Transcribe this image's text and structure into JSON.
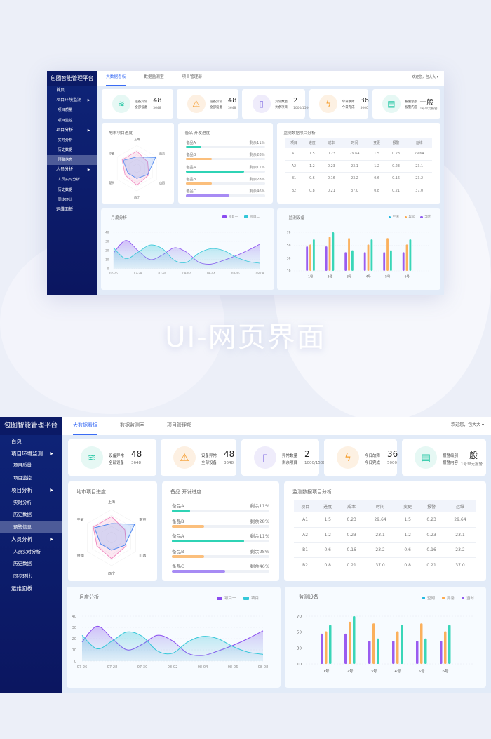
{
  "banner_title": "UI-网页界面",
  "app": {
    "title": "包图智能管理平台"
  },
  "sidebar": {
    "items": [
      {
        "label": "首页",
        "sub": false,
        "arrow": false
      },
      {
        "label": "项目环境监测",
        "sub": false,
        "arrow": true
      },
      {
        "label": "项目质量",
        "sub": true
      },
      {
        "label": "项目监控",
        "sub": true
      },
      {
        "label": "项目分析",
        "sub": false,
        "arrow": true
      },
      {
        "label": "实时分析",
        "sub": true
      },
      {
        "label": "历史数据",
        "sub": true
      },
      {
        "label": "预警信息",
        "sub": true,
        "active": true
      },
      {
        "label": "人员分析",
        "sub": false,
        "arrow": true
      },
      {
        "label": "人员实时分析",
        "sub": true
      },
      {
        "label": "历史数据",
        "sub": true
      },
      {
        "label": "同步环比",
        "sub": true
      },
      {
        "label": "运维面板",
        "sub": false
      }
    ]
  },
  "header": {
    "tabs": [
      {
        "label": "大数据看板",
        "active": true
      },
      {
        "label": "数据监测室"
      },
      {
        "label": "项目管理部"
      }
    ],
    "welcome": "欢迎您，包大大 ▾"
  },
  "stats": [
    {
      "icon": "layers-icon",
      "glyph": "≋",
      "color": "#2ec9a8",
      "bg": "#e6f8f4",
      "l1": "设备异常",
      "l2": "全部设备",
      "v1": "48",
      "v2": "3648"
    },
    {
      "icon": "warning-icon",
      "glyph": "⚠",
      "color": "#f59a2a",
      "bg": "#fdf0e2",
      "l1": "设备异常",
      "l2": "全部设备",
      "v1": "48",
      "v2": "3648"
    },
    {
      "icon": "book-icon",
      "glyph": "▯",
      "color": "#8b78e6",
      "bg": "#efecfb",
      "l1": "异常数量",
      "l2": "剩余项目",
      "v1": "2",
      "v2": "1000/1500"
    },
    {
      "icon": "lightning-icon",
      "glyph": "ϟ",
      "color": "#f5a030",
      "bg": "#fdf1e3",
      "l1": "今日故障",
      "l2": "今日完成",
      "v1": "36",
      "v2": "5000"
    },
    {
      "icon": "document-icon",
      "glyph": "▤",
      "color": "#2ec9a8",
      "bg": "#e6f8f4",
      "l1": "报警级别",
      "l2": "报警内容",
      "v1": "一般",
      "v2": "1号单元报警"
    }
  ],
  "radar": {
    "title": "地市项目进度",
    "axes": [
      "上海",
      "南京",
      "山西",
      "西宁",
      "楚明",
      "宁夏"
    ],
    "series": [
      {
        "color": "#f08bc0",
        "values": [
          0.75,
          0.55,
          0.6,
          0.75,
          0.6,
          0.75
        ]
      },
      {
        "color": "#4d86f0",
        "values": [
          0.5,
          0.95,
          0.55,
          0.45,
          0.45,
          0.7
        ]
      }
    ]
  },
  "progress": {
    "title": "备品 开发进度",
    "items": [
      {
        "label": "备品A",
        "remain": "剩余11%",
        "fill": 19,
        "color": "#2fd3b5"
      },
      {
        "label": "备品B",
        "remain": "剩余28%",
        "fill": 33,
        "color": "#fbbf7c"
      },
      {
        "label": "备品A",
        "remain": "剩余11%",
        "fill": 74,
        "color": "#2fd3b5"
      },
      {
        "label": "备品B",
        "remain": "剩余28%",
        "fill": 33,
        "color": "#fbbf7c"
      },
      {
        "label": "备品C",
        "remain": "剩余46%",
        "fill": 55,
        "color": "#a78bf4"
      }
    ]
  },
  "table": {
    "title": "监测数据项目分析",
    "columns": [
      "项目",
      "进度",
      "成本",
      "时间",
      "变更",
      "报警",
      "运维"
    ],
    "rows": [
      [
        "A1",
        "1.5",
        "0.23",
        "29.64",
        "1.5",
        "0.23",
        "29.64"
      ],
      [
        "A2",
        "1.2",
        "0.23",
        "23.1",
        "1.2",
        "0.23",
        "23.1"
      ],
      [
        "B1",
        "0.6",
        "0.16",
        "23.2",
        "0.6",
        "0.16",
        "23.2"
      ],
      [
        "B2",
        "0.8",
        "0.21",
        "37.0",
        "0.8",
        "0.21",
        "37.0"
      ]
    ]
  },
  "chart_data": [
    {
      "type": "area",
      "title": "月度分析",
      "categories": [
        "07-26",
        "07-27",
        "07-28",
        "07-29",
        "07-30",
        "08-01",
        "08-02",
        "08-03",
        "08-04",
        "08-05",
        "08-06",
        "08-07",
        "08-08"
      ],
      "xticks": [
        "07-26",
        "07-28",
        "07-30",
        "08-02",
        "08-04",
        "08-06",
        "08-08"
      ],
      "ylim": [
        0,
        40
      ],
      "yticks": [
        0,
        10,
        20,
        30,
        40
      ],
      "series": [
        {
          "name": "项目一",
          "color": "#8a4cf0",
          "values": [
            17,
            31,
            20,
            10,
            15,
            23,
            18,
            7,
            5,
            9,
            14,
            20,
            27
          ]
        },
        {
          "name": "项目二",
          "color": "#34c7d8",
          "values": [
            23,
            11,
            18,
            26,
            22,
            9,
            7,
            17,
            22,
            20,
            13,
            8,
            6
          ]
        }
      ]
    },
    {
      "type": "bar",
      "title": "监测设备",
      "categories": [
        "1号",
        "2号",
        "3号",
        "4号",
        "5号",
        "6号"
      ],
      "ylim": [
        10,
        70
      ],
      "yticks": [
        10,
        30,
        50,
        70
      ],
      "legend": [
        {
          "name": "空闲",
          "color": "#1fb8e0"
        },
        {
          "name": "异常",
          "color": "#fba94c"
        },
        {
          "name": "当时",
          "color": "#8f5cf0"
        }
      ],
      "series": [
        {
          "color": "#9a5cf0",
          "values": [
            48,
            48,
            39,
            39,
            39,
            39
          ]
        },
        {
          "color": "#fbb05c",
          "values": [
            51,
            63,
            61,
            51,
            61,
            51
          ]
        },
        {
          "color": "#3ad6b8",
          "values": [
            59,
            70,
            42,
            59,
            42,
            59
          ]
        }
      ]
    }
  ]
}
